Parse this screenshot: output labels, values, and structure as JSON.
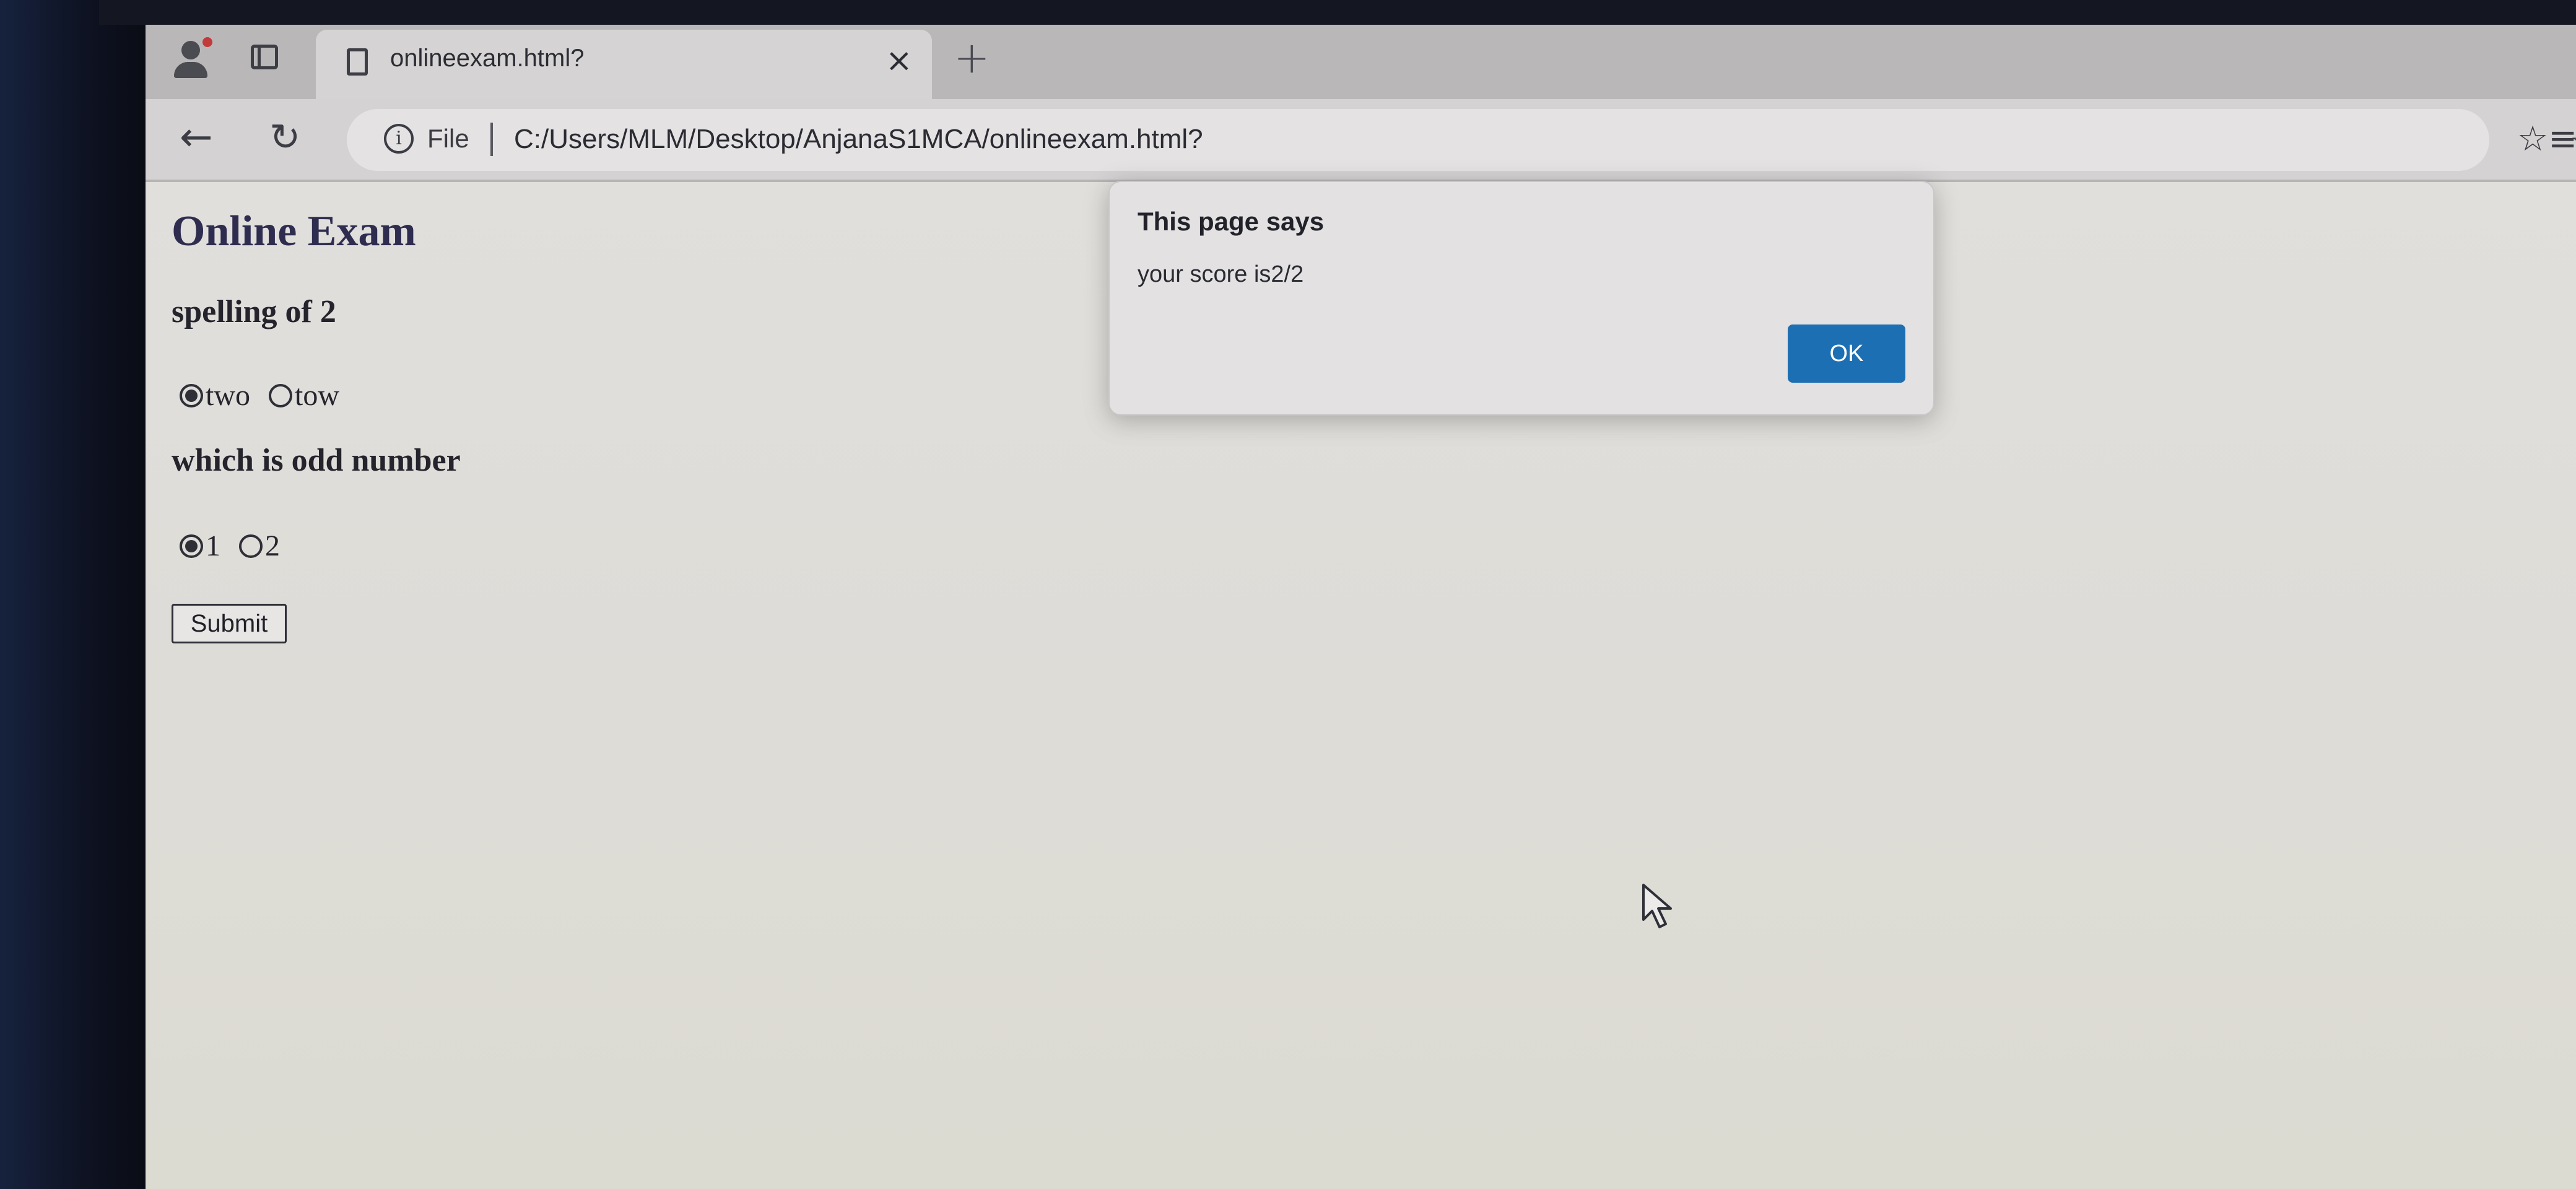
{
  "browser": {
    "tab": {
      "title": "onlineexam.html?",
      "close_glyph": "×",
      "new_tab_glyph": "+"
    },
    "toolbar": {
      "back_glyph": "←",
      "reload_glyph": "↻",
      "info_glyph": "i",
      "scheme_label": "File",
      "url": "C:/Users/MLM/Desktop/AnjanaS1MCA/onlineexam.html?",
      "star_glyph": "☆",
      "favorites_glyph": "☆≡"
    }
  },
  "page": {
    "title": "Online Exam",
    "questions": [
      {
        "text": "spelling of 2",
        "options": [
          {
            "label": "two",
            "checked": true
          },
          {
            "label": "tow",
            "checked": false
          }
        ]
      },
      {
        "text": "which is odd number",
        "options": [
          {
            "label": "1",
            "checked": true
          },
          {
            "label": "2",
            "checked": false
          }
        ]
      }
    ],
    "submit_label": "Submit"
  },
  "alert": {
    "title": "This page says",
    "message": "your score is2/2",
    "ok_label": "OK"
  },
  "colors": {
    "ok_button": "#1d6fb3",
    "page_title": "#2e2d50"
  },
  "icons": [
    "profile-icon",
    "tab-actions-icon",
    "file-icon",
    "close-icon",
    "plus-icon",
    "back-arrow-icon",
    "reload-icon",
    "info-icon",
    "star-icon",
    "favorites-icon",
    "mouse-pointer-icon"
  ]
}
